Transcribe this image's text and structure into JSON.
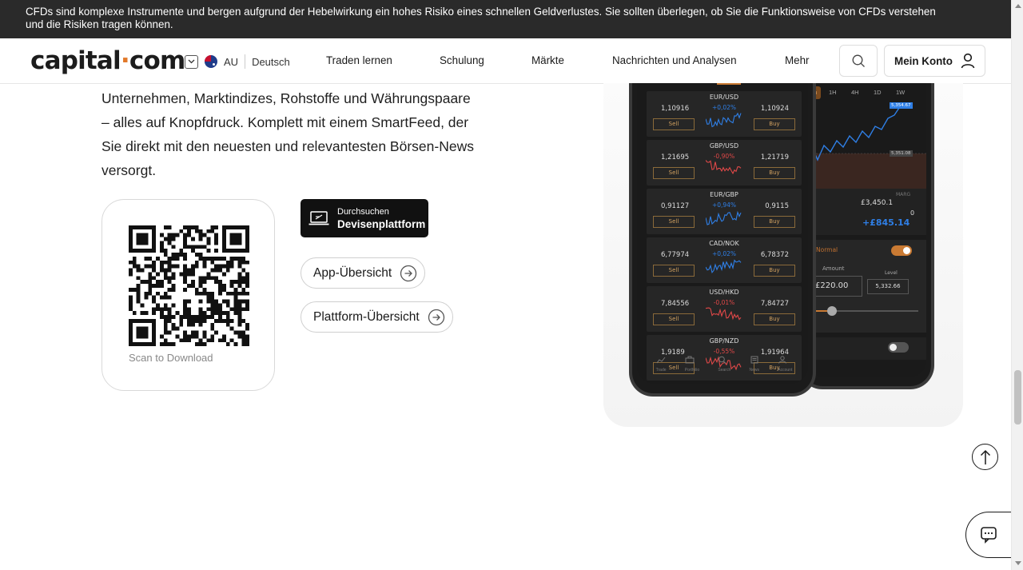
{
  "risk_banner": {
    "line1": "CFDs sind komplexe Instrumente und bergen aufgrund der Hebelwirkung ein hohes Risiko eines schnellen Geldverlustes. Sie sollten überlegen, ob Sie die Funktionsweise von CFDs verstehen",
    "line2": "und die Risiken tragen können."
  },
  "header": {
    "logo_left": "capital",
    "logo_dot": "·",
    "logo_right": "com",
    "region": "AU",
    "language": "Deutsch",
    "nav": [
      "Traden lernen",
      "Schulung",
      "Märkte",
      "Nachrichten und Analysen",
      "Mehr"
    ],
    "account_label": "Mein Konto"
  },
  "main": {
    "paragraph_lines": [
      "Unternehmen, Marktindizes, Rohstoffe und Währungspaare",
      "– alles auf Knopfdruck. Komplett mit einem SmartFeed, der",
      "Sie direkt mit den neuesten und relevantesten Börsen-News",
      "versorgt."
    ],
    "qr_label": "Scan to Download",
    "store_button": {
      "small": "Durchsuchen",
      "big": "Devisenplattform"
    },
    "app_overview": "App-Übersicht",
    "platform_overview": "Plattform-Übersicht"
  },
  "phone_left": {
    "rows": [
      {
        "pair": "EUR/USD",
        "change": "+0,02%",
        "sell": "1,10916",
        "buy": "1,10924",
        "dir": "up"
      },
      {
        "pair": "GBP/USD",
        "change": "-0,90%",
        "sell": "1,21695",
        "buy": "1,21719",
        "dir": "down"
      },
      {
        "pair": "EUR/GBP",
        "change": "+0,94%",
        "sell": "0,91127",
        "buy": "0,9115",
        "dir": "up"
      },
      {
        "pair": "CAD/NOK",
        "change": "+0,02%",
        "sell": "6,77974",
        "buy": "6,78372",
        "dir": "up"
      },
      {
        "pair": "USD/HKD",
        "change": "-0,01%",
        "sell": "7,84556",
        "buy": "7,84727",
        "dir": "down"
      },
      {
        "pair": "GBP/NZD",
        "change": "-0,55%",
        "sell": "1,9189",
        "buy": "1,91964",
        "dir": "down"
      }
    ],
    "sell_label": "Sell",
    "buy_label": "Buy",
    "tabs": [
      "Trade",
      "Portfolio",
      "Search",
      "News",
      "Account"
    ]
  },
  "phone_right": {
    "timeframes": [
      "5m",
      "1H",
      "4H",
      "1D",
      "1W"
    ],
    "price_tag_top": "5,354.67",
    "price_tag_mid": "5,351.08",
    "margin_label": "MARG",
    "balance": "£3,450.1",
    "zero": "0",
    "pnl": "+£845.14",
    "mode": "Normal",
    "amount_label": "Amount",
    "level_label": "Level",
    "amount_value": "£220.00",
    "level_value": "5,332.66"
  },
  "colors": {
    "banner_bg": "#2a2a2a",
    "brand_orange": "#e2792a",
    "up_blue": "#2f7fe6",
    "down_red": "#e04848"
  }
}
